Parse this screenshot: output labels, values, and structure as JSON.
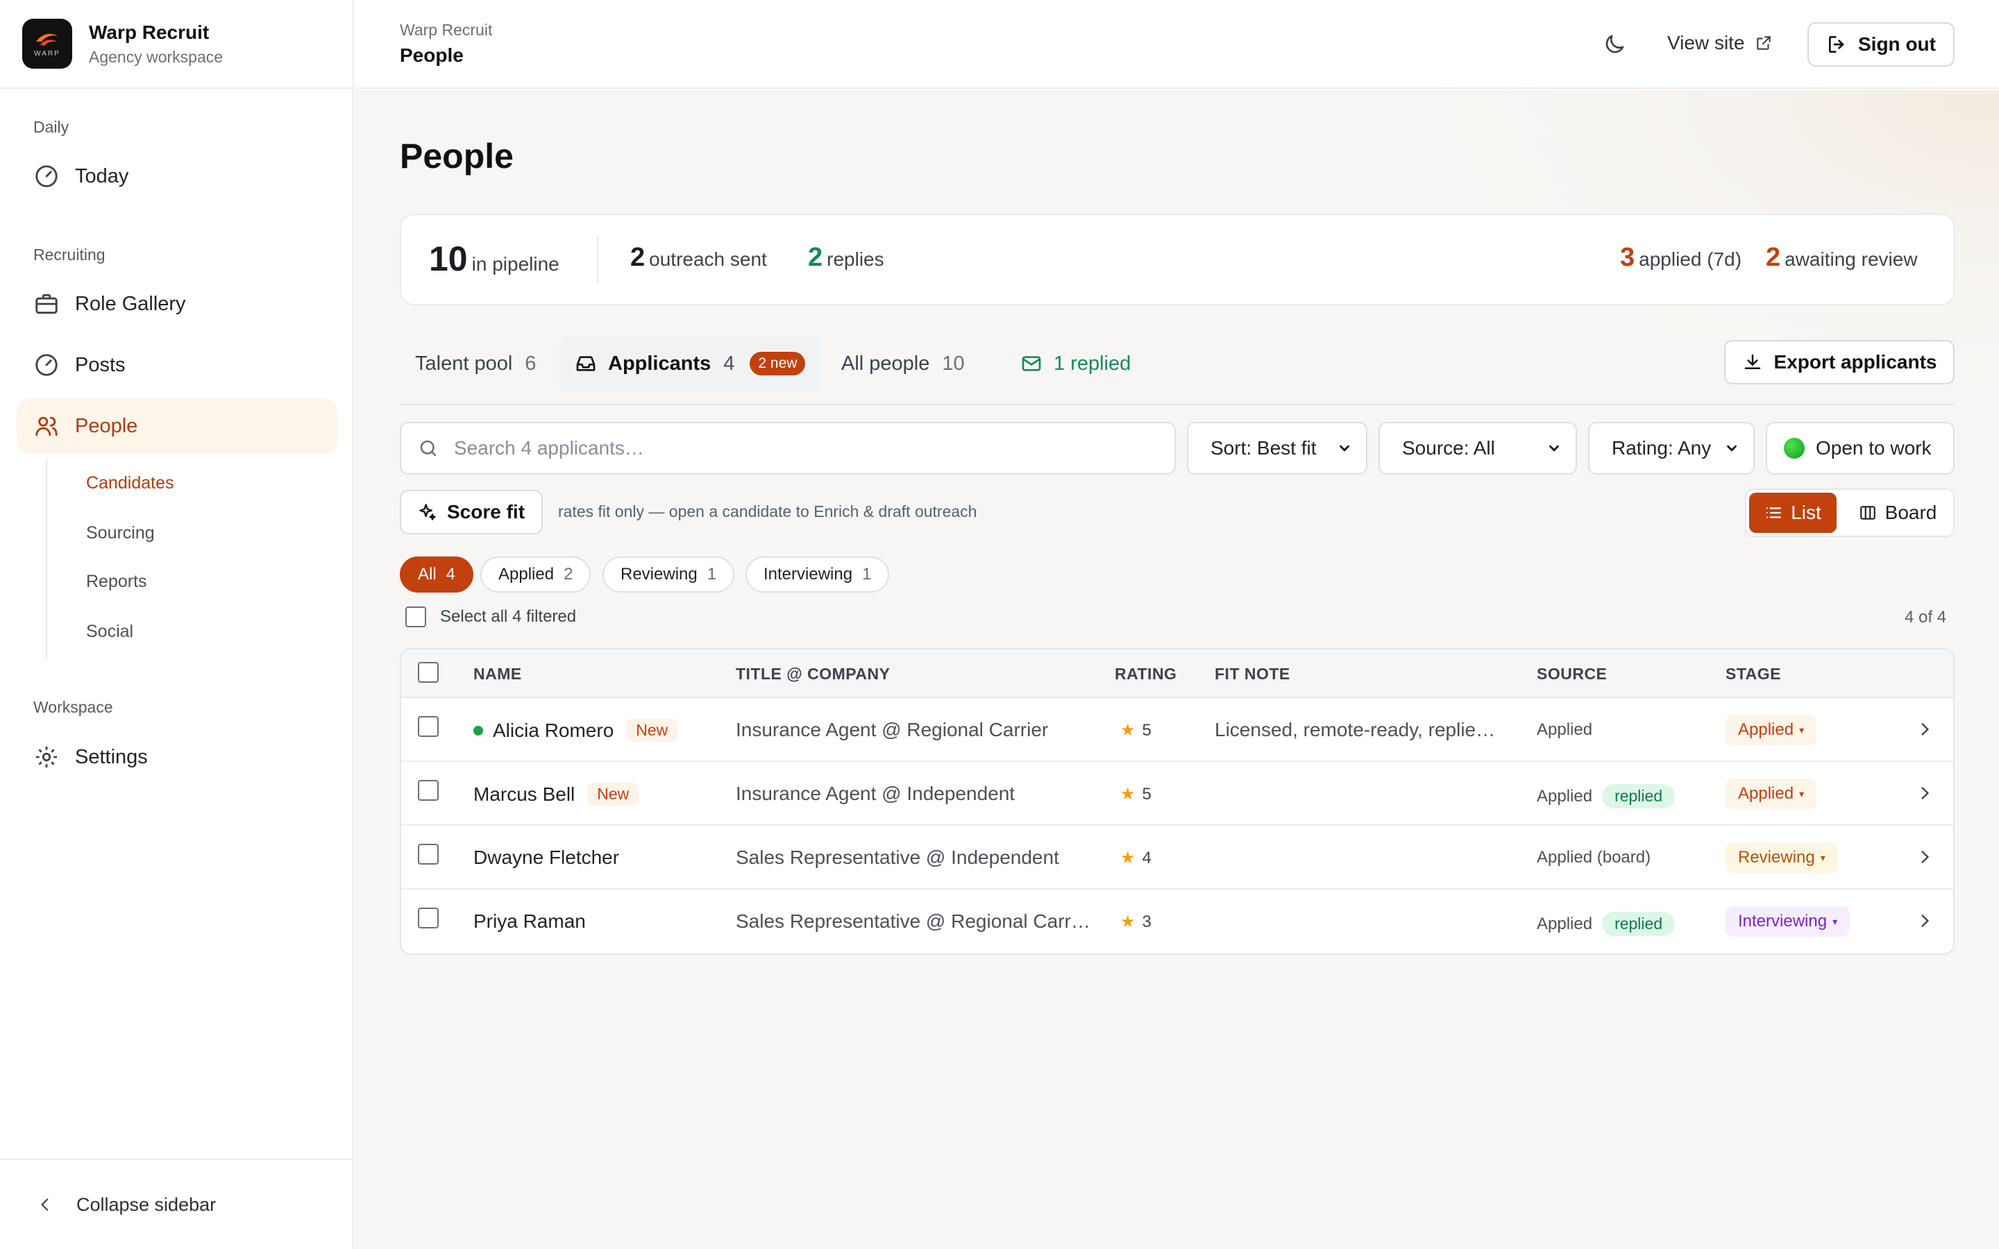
{
  "brand": {
    "name": "Warp Recruit",
    "subtitle": "Agency workspace",
    "logo_text": "WARP"
  },
  "sidebar": {
    "sections": [
      {
        "label": "Daily"
      },
      {
        "label": "Recruiting"
      },
      {
        "label": "Workspace"
      }
    ],
    "items": [
      {
        "label": "Today",
        "icon": "gauge-icon"
      },
      {
        "label": "Role Gallery",
        "icon": "briefcase-icon"
      },
      {
        "label": "Posts",
        "icon": "gauge-icon"
      },
      {
        "label": "People",
        "icon": "users-icon",
        "active": true
      },
      {
        "label": "Settings",
        "icon": "gear-icon"
      }
    ],
    "sub_items": [
      {
        "label": "Candidates",
        "active": true
      },
      {
        "label": "Sourcing"
      },
      {
        "label": "Reports"
      },
      {
        "label": "Social"
      }
    ],
    "collapse_label": "Collapse sidebar"
  },
  "header": {
    "breadcrumb_app": "Warp Recruit",
    "breadcrumb_page": "People",
    "view_site": "View site",
    "sign_out": "Sign out"
  },
  "page": {
    "title": "People"
  },
  "stats": {
    "pipeline": {
      "value": "10",
      "label": "in pipeline"
    },
    "outreach": {
      "value": "2",
      "label": "outreach sent"
    },
    "replies": {
      "value": "2",
      "label": "replies"
    },
    "applied": {
      "value": "3",
      "label": "applied (7d)"
    },
    "awaiting": {
      "value": "2",
      "label": "awaiting review"
    }
  },
  "tabs": [
    {
      "label": "Talent pool",
      "count": "6"
    },
    {
      "label": "Applicants",
      "count": "4",
      "badge": "2 new",
      "active": true
    },
    {
      "label": "All people",
      "count": "10"
    },
    {
      "label": "1 replied"
    }
  ],
  "export_label": "Export applicants",
  "search": {
    "placeholder": "Search 4 applicants…"
  },
  "filters": {
    "sort": "Sort: Best fit",
    "source": "Source: All",
    "rating": "Rating: Any",
    "open_to_work": "Open to work"
  },
  "score": {
    "label": "Score fit",
    "note": "rates fit only — open a candidate to Enrich & draft outreach"
  },
  "view_toggle": {
    "list": "List",
    "board": "Board",
    "selected": "List"
  },
  "stage_chips": [
    {
      "label": "All",
      "count": "4",
      "active": true
    },
    {
      "label": "Applied",
      "count": "2"
    },
    {
      "label": "Reviewing",
      "count": "1"
    },
    {
      "label": "Interviewing",
      "count": "1"
    }
  ],
  "select_all_label": "Select all 4 filtered",
  "result_count": "4 of 4",
  "table": {
    "columns": [
      "NAME",
      "TITLE @ COMPANY",
      "RATING",
      "FIT NOTE",
      "SOURCE",
      "STAGE"
    ],
    "rows": [
      {
        "name": "Alicia Romero",
        "online": true,
        "new_tag": "New",
        "title": "Insurance Agent @ Regional Carrier",
        "rating": "5",
        "fit_note": "Licensed, remote-ready, replie…",
        "source": "Applied",
        "replied": "",
        "stage": "Applied"
      },
      {
        "name": "Marcus Bell",
        "online": false,
        "new_tag": "New",
        "title": "Insurance Agent @ Independent",
        "rating": "5",
        "fit_note": "",
        "source": "Applied",
        "replied": "replied",
        "stage": "Applied"
      },
      {
        "name": "Dwayne Fletcher",
        "online": false,
        "new_tag": "",
        "title": "Sales Representative @ Independent",
        "rating": "4",
        "fit_note": "",
        "source": "Applied (board)",
        "replied": "",
        "stage": "Reviewing"
      },
      {
        "name": "Priya Raman",
        "online": false,
        "new_tag": "",
        "title": "Sales Representative @ Regional Carr…",
        "rating": "3",
        "fit_note": "",
        "source": "Applied",
        "replied": "replied",
        "stage": "Interviewing"
      }
    ]
  },
  "colors": {
    "accent": "#c2410c",
    "green": "#148a58",
    "active_bg": "#fdf4ea"
  }
}
